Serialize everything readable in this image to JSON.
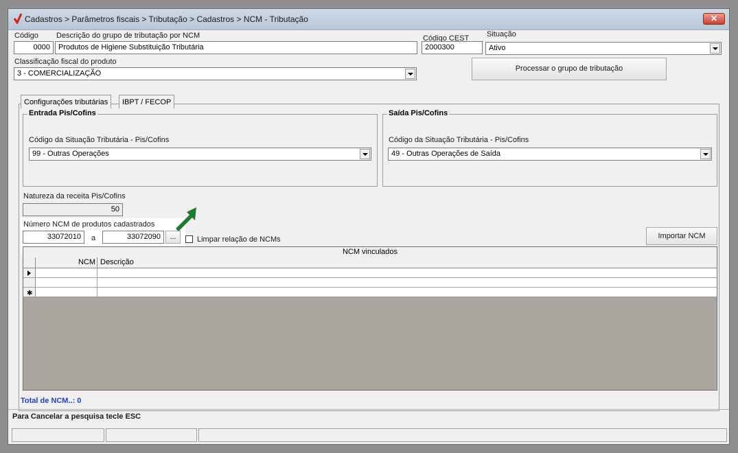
{
  "window": {
    "breadcrumb": "Cadastros > Parâmetros fiscais > Tributação > Cadastros > NCM - Tributação",
    "close_label": "✕"
  },
  "header": {
    "codigo_label": "Código",
    "codigo_value": "0000",
    "descricao_label": "Descrição do grupo de tributação por NCM",
    "descricao_value": "Produtos de Higiene Substituição Tributária",
    "cest_label": "Código CEST",
    "cest_value": "2000300",
    "situacao_label": "Situação",
    "situacao_value": "Ativo",
    "classificacao_label": "Classificação fiscal do produto",
    "classificacao_value": "3 - COMERCIALIZAÇÃO",
    "processar_label": "Processar o grupo de tributação"
  },
  "tabs": [
    {
      "label": "Configurações tributárias"
    },
    {
      "label": "IBPT / FECOP"
    }
  ],
  "entrada": {
    "title": "Entrada Pis/Cofins",
    "cst_label": "Código da Situação Tributária - Pis/Cofins",
    "cst_value": "99 -  Outras Operações"
  },
  "saida": {
    "title": "Saída Pis/Cofins",
    "cst_label": "Código da Situação Tributária - Pis/Cofins",
    "cst_value": "49 -  Outras Operações de Saída"
  },
  "natureza": {
    "label": "Natureza da receita Pis/Cofins",
    "value": "50"
  },
  "ncm_range": {
    "label": "Número  NCM de produtos cadastrados",
    "from": "33072010",
    "sep": "a",
    "to": "33072090",
    "browse_label": "...",
    "limpar_label": "Limpar relação de NCMs",
    "importar_label": "Importar NCM"
  },
  "grid": {
    "caption": "NCM vinculados",
    "col_ncm": "NCM",
    "col_desc": "Descrição"
  },
  "footer": {
    "total": "Total de NCM..: 0",
    "hint": "Para Cancelar a pesquisa tecle ESC"
  },
  "colors": {
    "total_text": "#1f3fbf",
    "arrow": "#1e7a2e"
  }
}
